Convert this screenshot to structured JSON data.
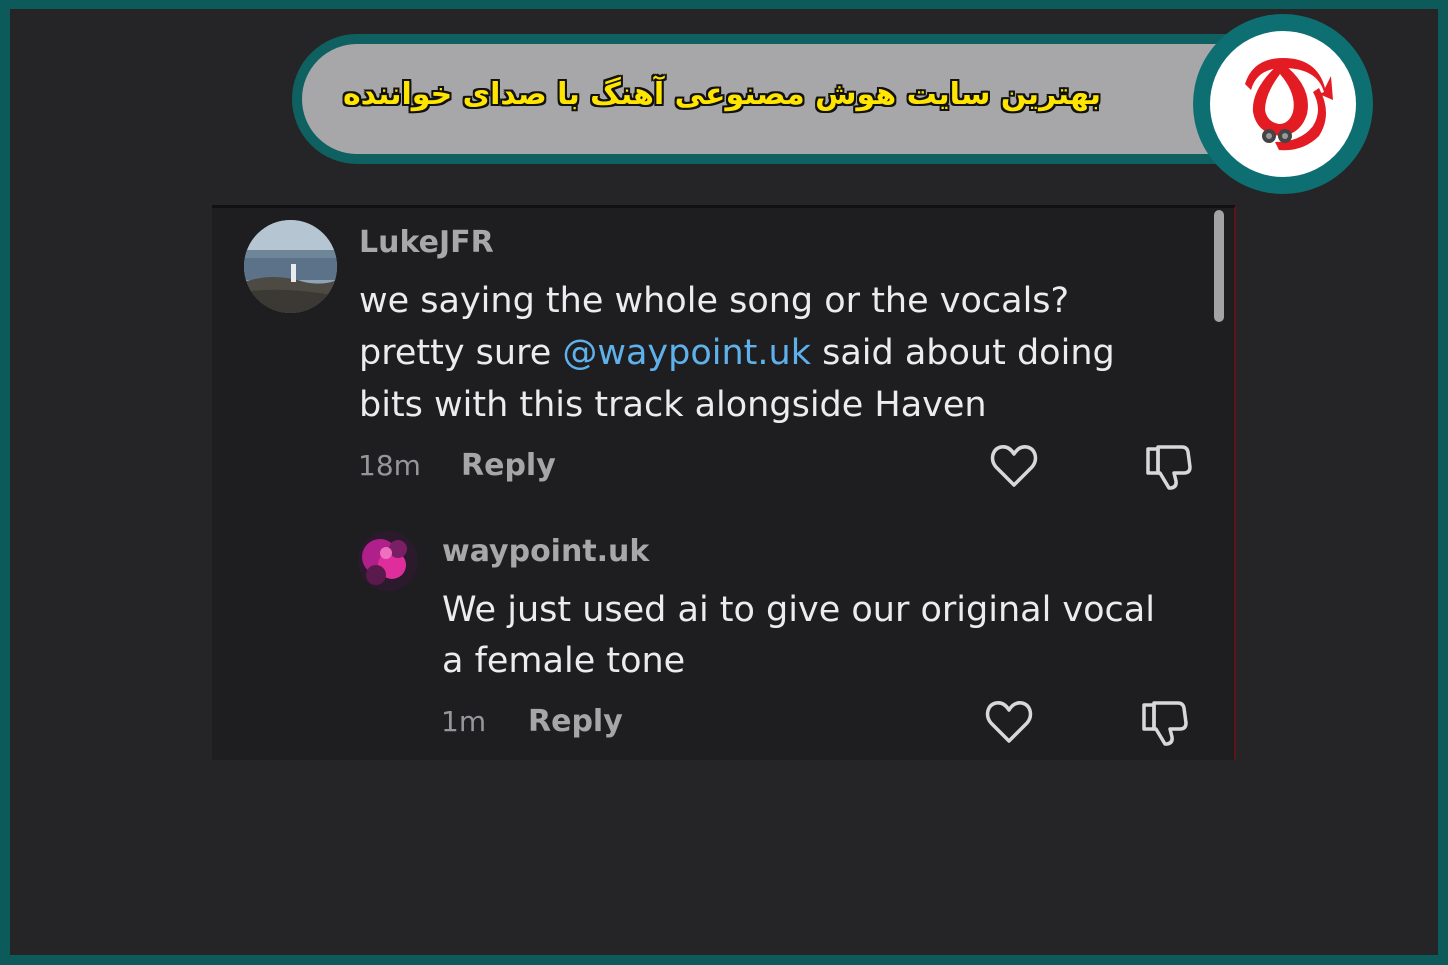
{
  "banner": {
    "title": "بهترین سایت هوش مصنوعی آهنگ با صدای خواننده"
  },
  "colors": {
    "frame_border": "#0c5a5a",
    "banner_fill": "#a7a7a9",
    "banner_title": "#ffe500",
    "logo_red": "#e31b23",
    "mention": "#5fb1ec",
    "comment_text": "#ececee"
  },
  "icons": {
    "logo": "brand-logo",
    "like": "heart-icon",
    "dislike": "thumbs-down-icon"
  },
  "comments": [
    {
      "username": "LukeJFR",
      "lines": [
        {
          "text": "we saying the whole song or the vocals?"
        },
        {
          "before": "pretty sure ",
          "mention": "@waypoint.uk",
          "after": " said about doing"
        },
        {
          "text": "bits with this track alongside Haven"
        }
      ],
      "time": "18m",
      "reply_label": "Reply"
    },
    {
      "username": "waypoint.uk",
      "lines": [
        {
          "text": "We just used ai to give our original vocal"
        },
        {
          "text": "a female tone"
        }
      ],
      "time": "1m",
      "reply_label": "Reply"
    }
  ]
}
